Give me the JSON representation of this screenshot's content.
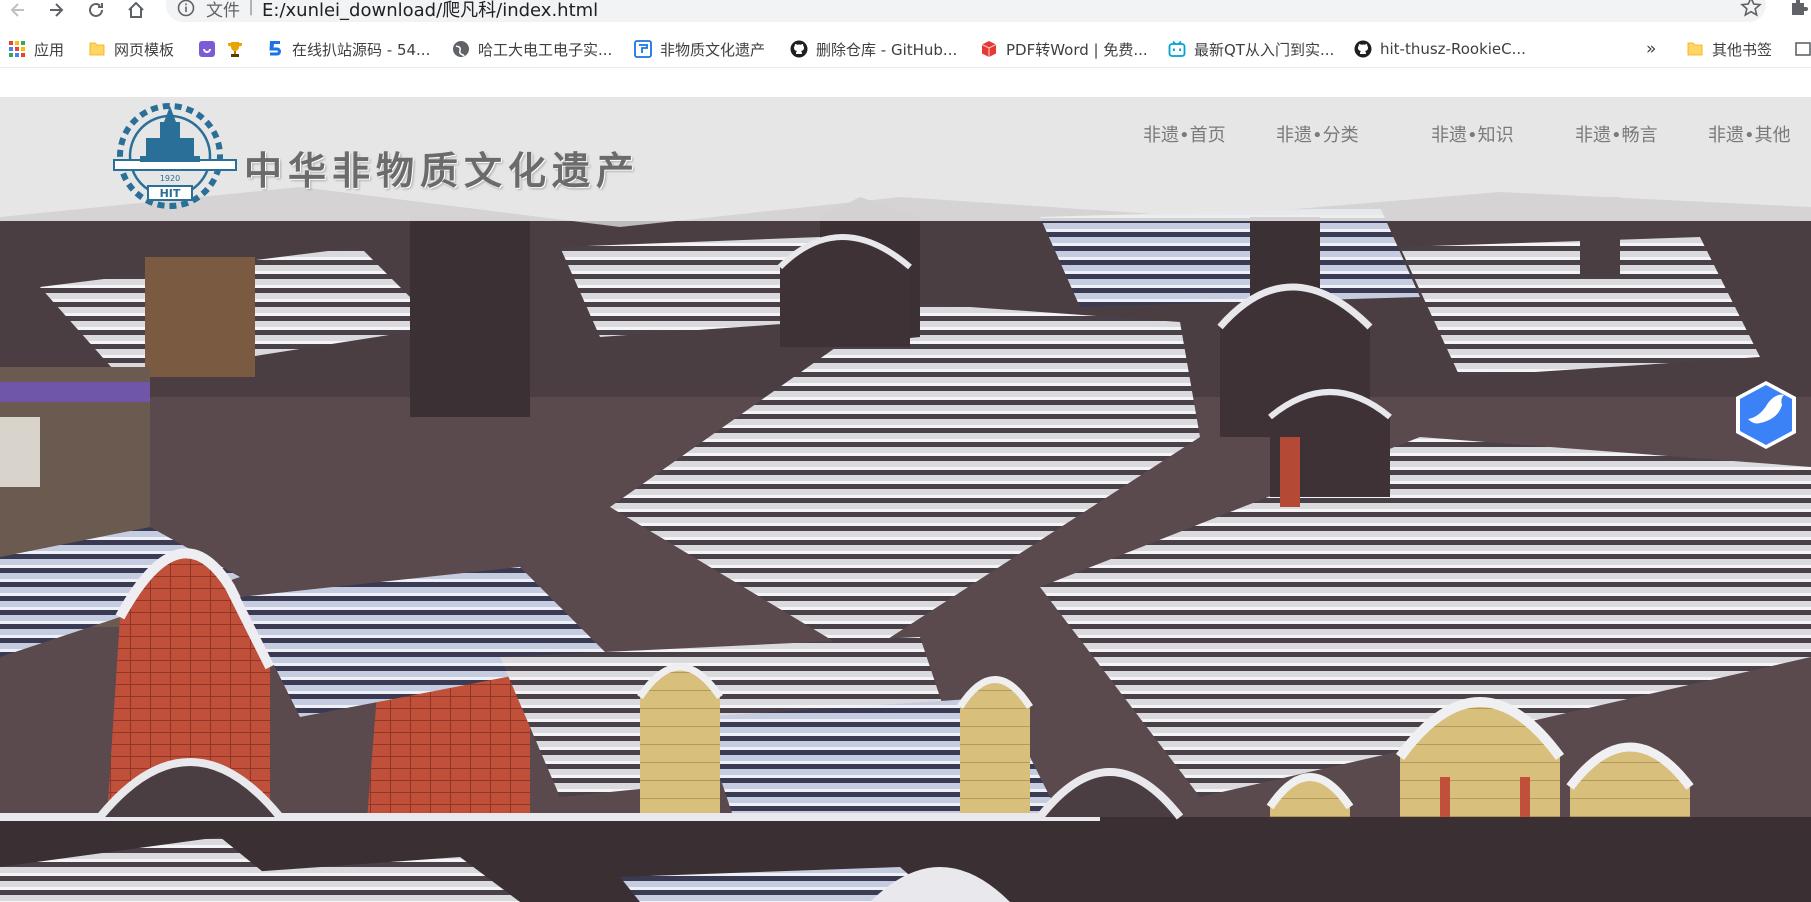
{
  "browser": {
    "address_prefix": "文件",
    "address_separator": "|",
    "url": "E:/xunlei_download/爬凡科/index.html"
  },
  "bookmarks": [
    {
      "label": "应用",
      "icon": "apps-grid-icon"
    },
    {
      "label": "网页模板",
      "icon": "folder-icon"
    },
    {
      "label": "",
      "icon": "purple-app-icon"
    },
    {
      "label": "",
      "icon": "trophy-icon"
    },
    {
      "label": "在线扒站源码 - 54...",
      "icon": "five-logo-icon"
    },
    {
      "label": "哈工大电工电子实...",
      "icon": "globe-icon"
    },
    {
      "label": "非物质文化遗产",
      "icon": "site-logo-icon"
    },
    {
      "label": "删除仓库 - GitHub...",
      "icon": "github-icon"
    },
    {
      "label": "PDF转Word | 免费...",
      "icon": "pdf-box-icon"
    },
    {
      "label": "最新QT从入门到实...",
      "icon": "bilibili-icon"
    },
    {
      "label": "hit-thusz-RookieC...",
      "icon": "github-icon"
    },
    {
      "label": "»",
      "icon": "overflow-chevron-icon"
    },
    {
      "label": "其他书签",
      "icon": "folder-icon"
    }
  ],
  "site": {
    "title": "中华非物质文化遗产",
    "logo_text": "HIT",
    "logo_year": "1920",
    "nav": [
      "非遗•首页",
      "非遗•分类",
      "非遗•知识",
      "非遗•畅言",
      "非遗•其他"
    ]
  },
  "colors": {
    "header_bg": "#ececec",
    "nav_text": "#7a7a7a",
    "title_text": "#6b6b6b",
    "logo_blue": "#2a6f97",
    "badge_blue": "#3b82f6"
  }
}
